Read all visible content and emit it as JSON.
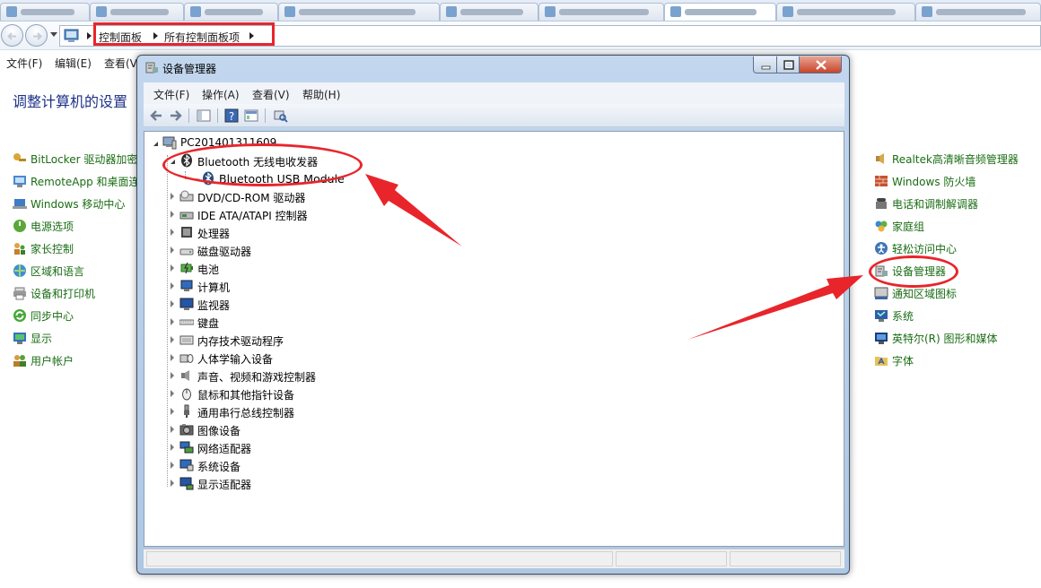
{
  "breadcrumb": {
    "items": [
      "控制面板",
      "所有控制面板项"
    ]
  },
  "cp_menu": [
    "文件(F)",
    "编辑(E)",
    "查看(V)"
  ],
  "cp_title": "调整计算机的设置",
  "cp_left_items": [
    "BitLocker 驱动器加密",
    "RemoteApp 和桌面连",
    "Windows 移动中心",
    "电源选项",
    "家长控制",
    "区域和语言",
    "设备和打印机",
    "同步中心",
    "显示",
    "用户帐户"
  ],
  "cp_right_items": [
    "Realtek高清晰音频管理器",
    "Windows 防火墙",
    "电话和调制解调器",
    "家庭组",
    "轻松访问中心",
    "设备管理器",
    "通知区域图标",
    "系统",
    "英特尔(R) 图形和媒体",
    "字体"
  ],
  "device_manager": {
    "title": "设备管理器",
    "menu": [
      "文件(F)",
      "操作(A)",
      "查看(V)",
      "帮助(H)"
    ],
    "root": "PC201401311609",
    "bluetooth": {
      "label": "Bluetooth 无线电收发器",
      "child": "Bluetooth USB Module"
    },
    "categories": [
      "DVD/CD-ROM 驱动器",
      "IDE ATA/ATAPI 控制器",
      "处理器",
      "磁盘驱动器",
      "电池",
      "计算机",
      "监视器",
      "键盘",
      "内存技术驱动程序",
      "人体学输入设备",
      "声音、视频和游戏控制器",
      "鼠标和其他指针设备",
      "通用串行总线控制器",
      "图像设备",
      "网络适配器",
      "系统设备",
      "显示适配器"
    ]
  },
  "colors": {
    "annotation_red": "#e8252b",
    "link_green": "#1a6c14",
    "title_blue": "#1e3287"
  }
}
